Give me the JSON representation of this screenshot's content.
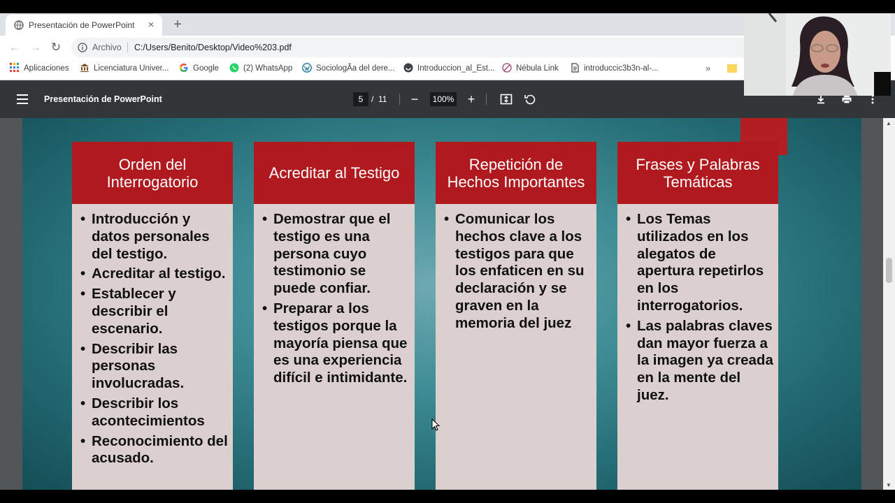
{
  "browser": {
    "tab_title": "Presentación de PowerPoint",
    "tab_close": "×",
    "new_tab": "+",
    "address_scheme": "Archivo",
    "address_url": "C:/Users/Benito/Desktop/Video%203.pdf",
    "bookmarks": [
      {
        "label": "Aplicaciones",
        "icon": "apps-grid-icon"
      },
      {
        "label": "Licenciatura Univer...",
        "icon": "university-icon"
      },
      {
        "label": "Google",
        "icon": "google-icon"
      },
      {
        "label": "(2) WhatsApp",
        "icon": "whatsapp-icon"
      },
      {
        "label": "SociologÃa del dere...",
        "icon": "wordpress-icon"
      },
      {
        "label": "Introduccion_al_Est...",
        "icon": "site-icon"
      },
      {
        "label": "Nébula Link",
        "icon": "nebula-icon"
      },
      {
        "label": "introduccic3b3n-al-...",
        "icon": "document-icon"
      }
    ],
    "bookmarks_more": "»"
  },
  "pdf_viewer": {
    "title": "Presentación de PowerPoint",
    "current_page": "5",
    "page_separator": "/",
    "total_pages": "11",
    "zoom": "100%",
    "zoom_out": "−",
    "zoom_in": "+"
  },
  "slide": {
    "columns": [
      {
        "heading": "Orden del Interrogatorio",
        "items": [
          "Introducción y datos personales del testigo.",
          "Acreditar al testigo.",
          "Establecer y describir el escenario.",
          "Describir las personas involucradas.",
          "Describir los acontecimientos",
          "Reconocimiento del acusado."
        ]
      },
      {
        "heading": "Acreditar al Testigo",
        "items": [
          "Demostrar que el testigo es una persona cuyo testimonio se puede confiar.",
          "Preparar a los testigos porque la mayoría piensa que es una experiencia difícil e intimidante."
        ]
      },
      {
        "heading": "Repetición de Hechos Importantes",
        "items": [
          "Comunicar los hechos clave a los testigos para que los enfaticen en su declaración y se graven en la memoria del juez"
        ]
      },
      {
        "heading": "Frases y Palabras Temáticas",
        "items": [
          "Los Temas utilizados en los alegatos de apertura repetirlos en los interrogatorios.",
          "Las palabras claves dan mayor fuerza a la imagen ya creada en la mente del juez."
        ]
      }
    ]
  },
  "colors": {
    "slide_header_red": "#b0191e",
    "slide_body_pink": "#dccfcf",
    "slide_background_teal": "#3f8d96",
    "pdf_toolbar": "#323639"
  }
}
